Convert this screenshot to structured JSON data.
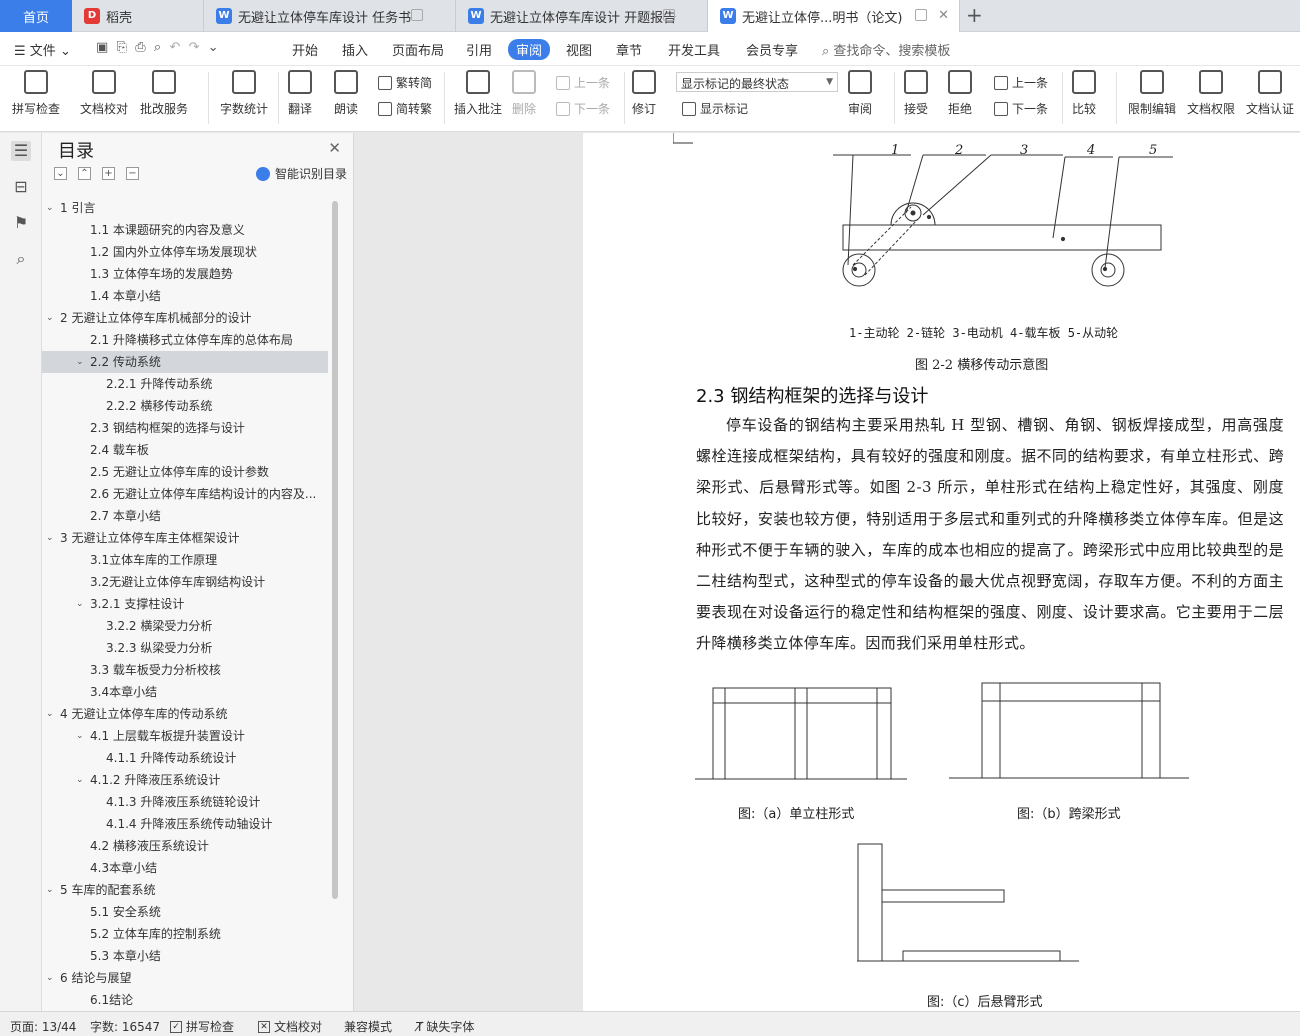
{
  "tabs": {
    "home": "首页",
    "daoke": "稻壳",
    "doc1": "无避让立体停车库设计 任务书",
    "doc2": "无避让立体停车库设计 开题报告",
    "doc3": "无避让立体停...明书（论文)"
  },
  "menu": {
    "file": "文件",
    "items": [
      "开始",
      "插入",
      "页面布局",
      "引用",
      "审阅",
      "视图",
      "章节",
      "开发工具",
      "会员专享"
    ],
    "search": "查找命令、搜索模板"
  },
  "ribbon": {
    "spell": "拼写检查",
    "proof": "文档校对",
    "annotate_service": "批改服务",
    "word_count": "字数统计",
    "translate": "翻译",
    "read_aloud": "朗读",
    "trad_to_simp": "繁转简",
    "simp_to_trad": "简转繁",
    "insert_comment": "插入批注",
    "delete": "删除",
    "prev_comment": "上一条",
    "next_comment": "下一条",
    "revise": "修订",
    "markup_state": "显示标记的最终状态",
    "show_markup": "显示标记",
    "review": "审阅",
    "accept": "接受",
    "reject": "拒绝",
    "prev_change": "上一条",
    "next_change": "下一条",
    "compare": "比较",
    "restrict": "限制编辑",
    "permission": "文档权限",
    "certify": "文档认证"
  },
  "nav": {
    "title": "目录",
    "smart": "智能识别目录",
    "toc": [
      {
        "label": "1  引言",
        "level": 1,
        "expanded": true
      },
      {
        "label": "1.1  本课题研究的内容及意义",
        "level": 2
      },
      {
        "label": "1.2  国内外立体停车场发展现状",
        "level": 2
      },
      {
        "label": "1.3  立体停车场的发展趋势",
        "level": 2
      },
      {
        "label": "1.4  本章小结",
        "level": 2
      },
      {
        "label": "2  无避让立体停车库机械部分的设计",
        "level": 1,
        "expanded": true
      },
      {
        "label": "2.1  升降横移式立体停车库的总体布局",
        "level": 2
      },
      {
        "label": "2.2  传动系统",
        "level": 2,
        "expanded": true,
        "selected": true
      },
      {
        "label": "2.2.1 升降传动系统",
        "level": 3
      },
      {
        "label": "2.2.2 横移传动系统",
        "level": 3
      },
      {
        "label": "2.3  钢结构框架的选择与设计",
        "level": 2
      },
      {
        "label": "2.4  载车板",
        "level": 2
      },
      {
        "label": "2.5  无避让立体停车库的设计参数",
        "level": 2
      },
      {
        "label": "2.6  无避让立体停车库结构设计的内容及...",
        "level": 2
      },
      {
        "label": "2.7  本章小结",
        "level": 2
      },
      {
        "label": "3  无避让立体停车库主体框架设计",
        "level": 1,
        "expanded": true
      },
      {
        "label": "3.1立体车库的工作原理",
        "level": 2
      },
      {
        "label": "3.2无避让立体停车库钢结构设计",
        "level": 2
      },
      {
        "label": "3.2.1  支撑柱设计",
        "level": 2,
        "expanded": true
      },
      {
        "label": "3.2.2  横梁受力分析",
        "level": 3
      },
      {
        "label": "3.2.3  纵梁受力分析",
        "level": 3
      },
      {
        "label": "3.3  载车板受力分析校核",
        "level": 2
      },
      {
        "label": "3.4本章小结",
        "level": 2
      },
      {
        "label": "4  无避让立体停车库的传动系统",
        "level": 1,
        "expanded": true
      },
      {
        "label": "4.1  上层载车板提升装置设计",
        "level": 2,
        "expanded": true
      },
      {
        "label": "4.1.1  升降传动系统设计",
        "level": 3
      },
      {
        "label": "4.1.2  升降液压系统设计",
        "level": 2,
        "expanded": true
      },
      {
        "label": "4.1.3  升降液压系统链轮设计",
        "level": 3
      },
      {
        "label": "4.1.4  升降液压系统传动轴设计",
        "level": 3
      },
      {
        "label": "4.2  横移液压系统设计",
        "level": 2
      },
      {
        "label": "4.3本章小结",
        "level": 2
      },
      {
        "label": "5  车库的配套系统",
        "level": 1,
        "expanded": true
      },
      {
        "label": "5.1  安全系统",
        "level": 2
      },
      {
        "label": "5.2  立体车库的控制系统",
        "level": 2
      },
      {
        "label": "5.3  本章小结",
        "level": 2
      },
      {
        "label": "6  结论与展望",
        "level": 1,
        "expanded": true
      },
      {
        "label": "6.1结论",
        "level": 2
      }
    ]
  },
  "document": {
    "fig22_numbers": [
      "1",
      "2",
      "3",
      "4",
      "5"
    ],
    "fig22_legend": "1-主动轮  2-链轮  3-电动机  4-载车板  5-从动轮",
    "fig22_caption": "图 2-2   横移传动示意图",
    "section_heading": "2.3  钢结构框架的选择与设计",
    "paragraph": "停车设备的钢结构主要采用热轧 H 型钢、槽钢、角钢、钢板焊接成型，用高强度螺栓连接成框架结构，具有较好的强度和刚度。据不同的结构要求，有单立柱形式、跨梁形式、后悬臂形式等。如图 2-3 所示，单柱形式在结构上稳定性好，其强度、刚度比较好，安装也较方便，特别适用于多层式和重列式的升降横移类立体停车库。但是这种形式不便于车辆的驶入，车库的成本也相应的提高了。跨梁形式中应用比较典型的是二柱结构型式，这种型式的停车设备的最大优点视野宽阔，存取车方便。不利的方面主要表现在对设备运行的稳定性和结构框架的强度、刚度、设计要求高。它主要用于二层升降横移类立体停车库。因而我们采用单柱形式。",
    "fig_a_caption": "图:（a）单立柱形式",
    "fig_b_caption": "图:（b）跨梁形式",
    "fig_c_caption": "图:（c）后悬臂形式"
  },
  "status": {
    "page": "页面: 13/44",
    "words": "字数: 16547",
    "spell": "拼写检查",
    "proof": "文档校对",
    "compat": "兼容模式",
    "missing_font": "缺失字体"
  },
  "colors": {
    "accent": "#3b7de9",
    "wps_red": "#e53935"
  }
}
